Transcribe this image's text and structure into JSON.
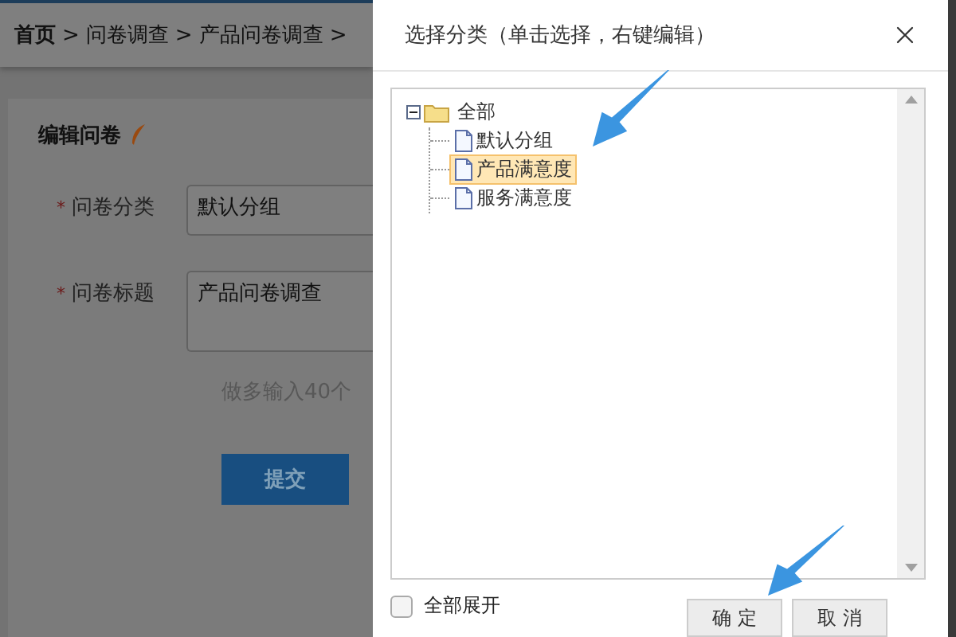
{
  "breadcrumb": [
    "首页",
    ">",
    "问卷调查",
    ">",
    "产品问卷调查",
    ">"
  ],
  "form": {
    "title": "编辑问卷",
    "fields": [
      {
        "label": "问卷分类",
        "required_mark": "*",
        "value": "默认分组",
        "kind": "input"
      },
      {
        "label": "问卷标题",
        "required_mark": "*",
        "value": "产品问卷调查",
        "kind": "textarea"
      }
    ],
    "hint": "做多输入40个",
    "submit": "提交"
  },
  "dialog": {
    "title": "选择分类（单击选择，右键编辑）",
    "tree": [
      {
        "label": "全部",
        "expanded": true,
        "selected": false,
        "children": [
          {
            "label": "默认分组",
            "selected": false
          },
          {
            "label": "产品满意度",
            "selected": true
          },
          {
            "label": "服务满意度",
            "selected": false
          }
        ]
      }
    ],
    "expand_all": {
      "label": "全部展开",
      "checked": false
    },
    "buttons": [
      "确 定",
      "取 消"
    ]
  }
}
